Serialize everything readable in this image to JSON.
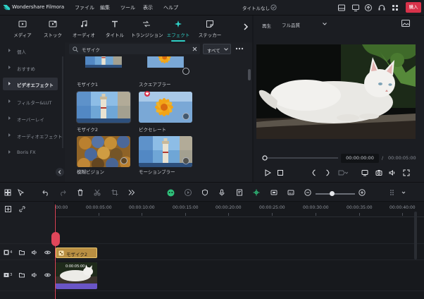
{
  "app": {
    "name": "Wondershare Filmora",
    "document_title": "タイトルなし",
    "buy_label": "購入"
  },
  "menu": [
    "ファイル",
    "編集",
    "ツール",
    "表示",
    "ヘルプ"
  ],
  "library_tabs": [
    {
      "label": "メディア",
      "icon": "media-icon"
    },
    {
      "label": "ストック",
      "icon": "stock-icon"
    },
    {
      "label": "オーディオ",
      "icon": "music-note-icon"
    },
    {
      "label": "タイトル",
      "icon": "title-t-icon"
    },
    {
      "label": "トランジション",
      "icon": "transition-icon"
    },
    {
      "label": "エフェクト",
      "icon": "sparkle-icon",
      "active": true
    },
    {
      "label": "ステッカー",
      "icon": "sticker-icon"
    }
  ],
  "sidebar": {
    "items": [
      {
        "label": "個人"
      },
      {
        "label": "おすすめ"
      },
      {
        "label": "ビデオエフェクト",
        "active": true
      },
      {
        "label": "フィルター&LUT"
      },
      {
        "label": "オーバーレイ"
      },
      {
        "label": "オーディオエフェクト"
      },
      {
        "label": "Boris FX"
      }
    ]
  },
  "effects_browser": {
    "search_value": "モザイク",
    "filter_value": "すべて",
    "effects": [
      {
        "label": "モザイク1",
        "thumb": "lighthouse"
      },
      {
        "label": "スクエアブラー",
        "thumb": "flower"
      },
      {
        "label": "モザイク2",
        "thumb": "lighthouse",
        "selected": true
      },
      {
        "label": "ピクセレート",
        "thumb": "flower"
      },
      {
        "label": "模糊ビジョン",
        "thumb": "mosaic"
      },
      {
        "label": "モーションブラー",
        "thumb": "lighthouse"
      }
    ]
  },
  "player": {
    "play_label": "再生",
    "quality": "フル品質",
    "current_time": "00:00:00:00",
    "separator": "/",
    "total_time": "00:00:05:00"
  },
  "timeline": {
    "ruler_labels": [
      "00:00",
      "00:00:05:00",
      "00:00:10:00",
      "00:00:15:00",
      "00:00:20:00",
      "00:00:25:00",
      "00:00:30:00",
      "00:00:35:00",
      "00:00:40:00"
    ],
    "tracks": [
      {
        "number": "4",
        "type": "effect"
      },
      {
        "number": "3",
        "type": "video"
      }
    ],
    "effect_clip_label": "モザイク2",
    "video_clip_tag": "0:00:05:00"
  },
  "colors": {
    "accent": "#2fd0c6",
    "buy_button": "#d8324a",
    "playhead": "#e0465a",
    "effect_clip": "#b98f42",
    "video_clip": "#6a55c6"
  }
}
